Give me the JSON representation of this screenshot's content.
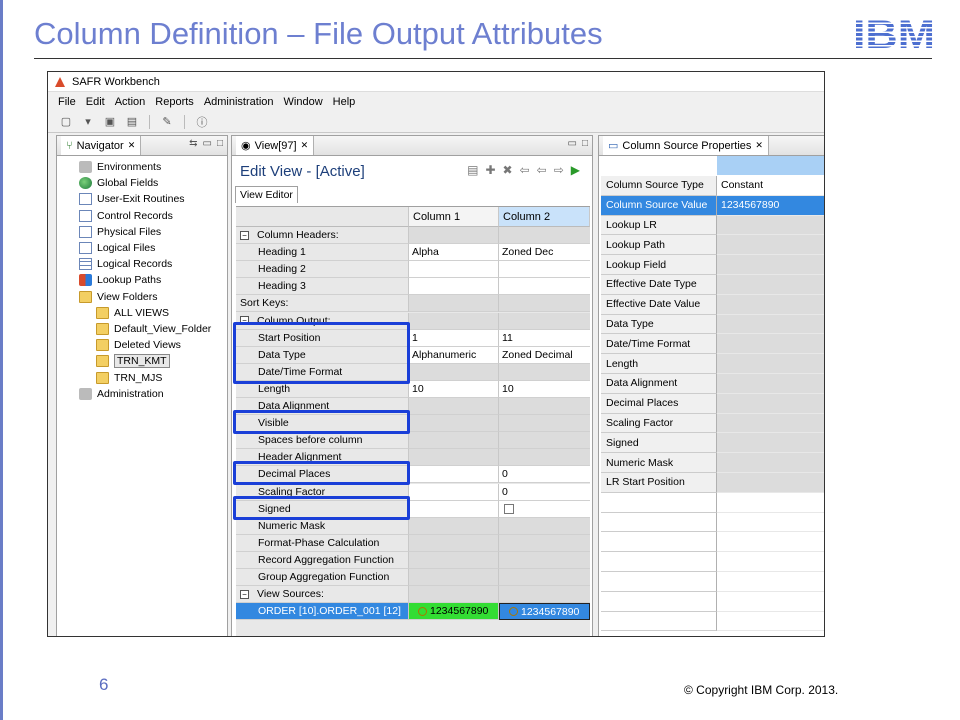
{
  "slide": {
    "title": "Column Definition – File Output Attributes",
    "logo": "IBM",
    "page_number": "6",
    "copyright": "© Copyright  IBM Corp. 2013."
  },
  "window": {
    "title": "SAFR Workbench",
    "menu": [
      "File",
      "Edit",
      "Action",
      "Reports",
      "Administration",
      "Window",
      "Help"
    ]
  },
  "navigator": {
    "tab_label": "Navigator",
    "items": [
      {
        "label": "Environments",
        "icon": "environments-icon"
      },
      {
        "label": "Global Fields",
        "icon": "globe-icon"
      },
      {
        "label": "User-Exit Routines",
        "icon": "routine-icon"
      },
      {
        "label": "Control Records",
        "icon": "document-icon"
      },
      {
        "label": "Physical Files",
        "icon": "document-icon"
      },
      {
        "label": "Logical Files",
        "icon": "document-icon"
      },
      {
        "label": "Logical Records",
        "icon": "grid-icon"
      },
      {
        "label": "Lookup Paths",
        "icon": "lookup-icon"
      },
      {
        "label": "View Folders",
        "icon": "folder-icon"
      }
    ],
    "folders": [
      "ALL VIEWS",
      "Default_View_Folder",
      "Deleted Views",
      "TRN_KMT",
      "TRN_MJS"
    ],
    "selected_folder": "TRN_KMT",
    "last_item": "Administration"
  },
  "view_editor": {
    "tab_label": "View[97]",
    "heading": "Edit View - [Active]",
    "subtab": "View Editor",
    "columns": [
      "Column 1",
      "Column 2"
    ],
    "rows": [
      {
        "label": "Column Headers:",
        "type": "section",
        "c1": "",
        "c2": ""
      },
      {
        "label": "Heading 1",
        "c1": "Alpha",
        "c2": "Zoned Dec"
      },
      {
        "label": "Heading 2",
        "c1": "",
        "c2": ""
      },
      {
        "label": "Heading 3",
        "c1": "",
        "c2": ""
      },
      {
        "label": "Sort Keys:",
        "type": "plain",
        "c1": "",
        "c2": ""
      },
      {
        "label": "Column Output:",
        "type": "section",
        "c1": "",
        "c2": ""
      },
      {
        "label": "Start Position",
        "c1": "1",
        "c2": "11"
      },
      {
        "label": "Data Type",
        "c1": "Alphanumeric",
        "c2": "Zoned Decimal"
      },
      {
        "label": "Date/Time Format",
        "c1": "",
        "c2": ""
      },
      {
        "label": "Length",
        "c1": "10",
        "c2": "10"
      },
      {
        "label": "Data Alignment",
        "c1": "",
        "c2": ""
      },
      {
        "label": "Visible",
        "c1": "",
        "c2": ""
      },
      {
        "label": "Spaces before column",
        "c1": "",
        "c2": ""
      },
      {
        "label": "Header Alignment",
        "c1": "",
        "c2": ""
      },
      {
        "label": "Decimal Places",
        "c1": "",
        "c2": "0"
      },
      {
        "label": "Scaling Factor",
        "c1": "",
        "c2": "0"
      },
      {
        "label": "Signed",
        "c1": "",
        "c2": "checkbox"
      },
      {
        "label": "Numeric Mask",
        "c1": "",
        "c2": ""
      },
      {
        "label": "Format-Phase Calculation",
        "c1": "",
        "c2": ""
      },
      {
        "label": "Record Aggregation Function",
        "c1": "",
        "c2": ""
      },
      {
        "label": "Group Aggregation Function",
        "c1": "",
        "c2": ""
      },
      {
        "label": "View Sources:",
        "type": "section",
        "c1": "",
        "c2": ""
      },
      {
        "label": "ORDER [10].ORDER_001 [12]",
        "type": "source",
        "c1": "1234567890",
        "c2": "1234567890"
      }
    ]
  },
  "properties": {
    "tab_label": "Column Source Properties",
    "rows": [
      {
        "key": "Column Source Type",
        "value": "Constant"
      },
      {
        "key": "Column Source Value",
        "value": "1234567890"
      },
      {
        "key": "Lookup LR",
        "value": ""
      },
      {
        "key": "Lookup Path",
        "value": ""
      },
      {
        "key": "Lookup Field",
        "value": ""
      },
      {
        "key": "Effective Date Type",
        "value": ""
      },
      {
        "key": "Effective Date Value",
        "value": ""
      },
      {
        "key": "Data Type",
        "value": ""
      },
      {
        "key": "Date/Time Format",
        "value": ""
      },
      {
        "key": "Length",
        "value": ""
      },
      {
        "key": "Data Alignment",
        "value": ""
      },
      {
        "key": "Decimal Places",
        "value": ""
      },
      {
        "key": "Scaling Factor",
        "value": ""
      },
      {
        "key": "Signed",
        "value": ""
      },
      {
        "key": "Numeric Mask",
        "value": ""
      },
      {
        "key": "LR Start Position",
        "value": ""
      }
    ]
  },
  "colors": {
    "title": "#6d7fd0",
    "highlight_box": "#1a3fd8",
    "selection": "#3388e0",
    "green_cell": "#33dd33"
  }
}
